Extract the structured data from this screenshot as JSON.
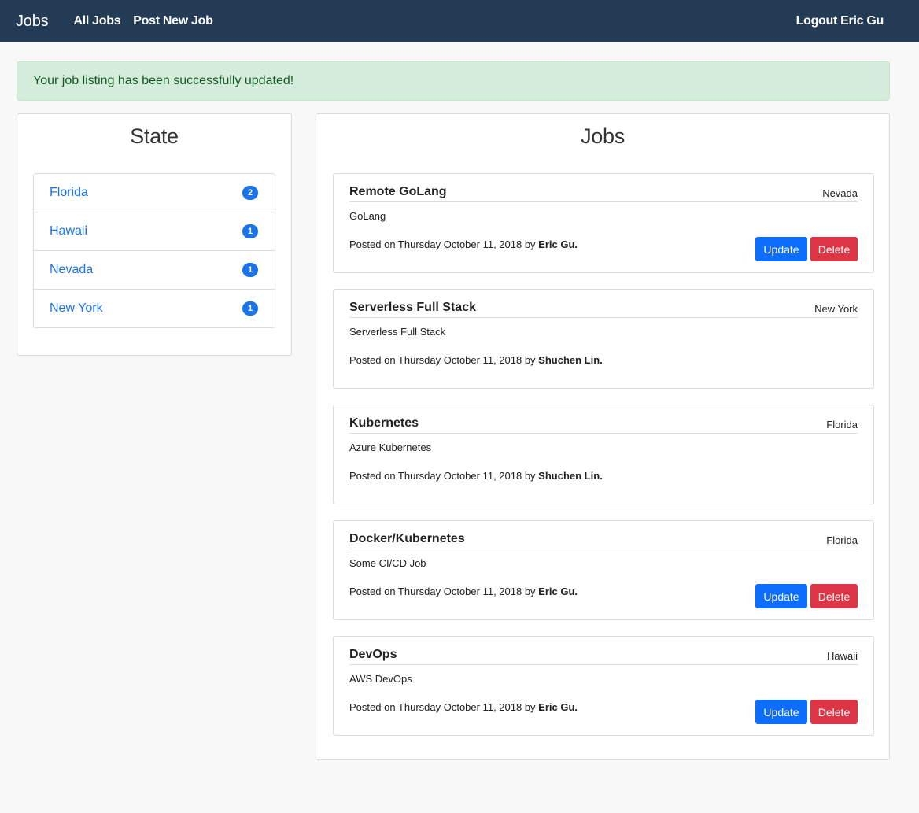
{
  "nav": {
    "brand": "Jobs",
    "links": [
      "All Jobs",
      "Post New Job"
    ],
    "logout": "Logout Eric Gu"
  },
  "alert": {
    "message": "Your job listing has been successfully updated!"
  },
  "state_panel": {
    "title": "State",
    "items": [
      {
        "label": "Florida",
        "count": "2"
      },
      {
        "label": "Hawaii",
        "count": "1"
      },
      {
        "label": "Nevada",
        "count": "1"
      },
      {
        "label": "New York",
        "count": "1"
      }
    ]
  },
  "jobs_panel": {
    "title": "Jobs",
    "update_label": "Update",
    "delete_label": "Delete",
    "jobs": [
      {
        "title": "Remote GoLang",
        "location": "Nevada",
        "description": "GoLang",
        "posted": "Posted on Thursday October 11, 2018 by",
        "author": "Eric Gu.",
        "editable": true
      },
      {
        "title": "Serverless Full Stack",
        "location": "New York",
        "description": "Serverless Full Stack",
        "posted": "Posted on Thursday October 11, 2018 by",
        "author": "Shuchen Lin.",
        "editable": false
      },
      {
        "title": "Kubernetes",
        "location": "Florida",
        "description": "Azure Kubernetes",
        "posted": "Posted on Thursday October 11, 2018 by",
        "author": "Shuchen Lin.",
        "editable": false
      },
      {
        "title": "Docker/Kubernetes",
        "location": "Florida",
        "description": "Some CI/CD Job",
        "posted": "Posted on Thursday October 11, 2018 by",
        "author": "Eric Gu.",
        "editable": true
      },
      {
        "title": "DevOps",
        "location": "Hawaii",
        "description": "AWS DevOps",
        "posted": "Posted on Thursday October 11, 2018 by",
        "author": "Eric Gu.",
        "editable": true
      }
    ]
  }
}
